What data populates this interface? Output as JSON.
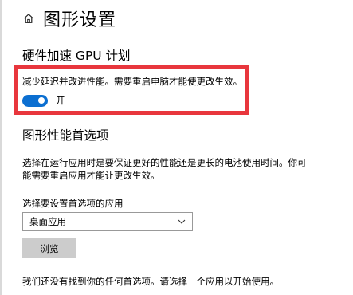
{
  "header": {
    "title": "图形设置",
    "home_icon": "home-icon"
  },
  "gpu_scheduling": {
    "title": "硬件加速 GPU 计划",
    "description": "减少延迟并改进性能。需要重启电脑才能使更改生效。",
    "toggle_state": "on",
    "toggle_label": "开"
  },
  "graphics_preference": {
    "title": "图形性能首选项",
    "description": "选择在运行应用时是要保证更好的性能还是更长的电池使用时间。你可能需要重启应用才能让更改生效。",
    "select_label": "选择要设置首选项的应用",
    "select_value": "桌面应用",
    "browse_label": "浏览",
    "empty_note": "我们还没有找到你的任何首选项。请选择一个应用以开始使用。"
  },
  "colors": {
    "accent": "#0b6fd1",
    "highlight_border": "#e8363d",
    "button_bg": "#cccccc"
  }
}
